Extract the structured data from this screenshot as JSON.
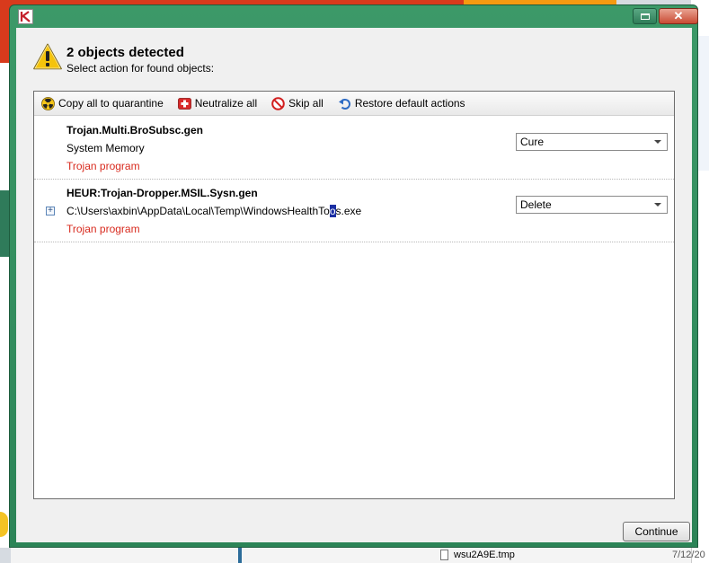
{
  "window": {
    "close_glyph": "✕",
    "app_icon": "kaspersky-k-icon"
  },
  "header": {
    "title": "2 objects detected",
    "subtitle": "Select action for found objects:",
    "icon": "warning-icon"
  },
  "toolbar": {
    "items": [
      {
        "label": "Copy all to quarantine",
        "icon": "radiation-icon"
      },
      {
        "label": "Neutralize all",
        "icon": "first-aid-icon"
      },
      {
        "label": "Skip all",
        "icon": "no-entry-icon"
      },
      {
        "label": "Restore default actions",
        "icon": "undo-icon"
      }
    ]
  },
  "objects": [
    {
      "name": "Trojan.Multi.BroSubsc.gen",
      "location": "System Memory",
      "type": "Trojan program",
      "action": "Cure"
    },
    {
      "name": "HEUR:Trojan-Dropper.MSIL.Sysn.gen",
      "location_prefix": "C:\\Users\\axbin\\AppData\\Local\\Temp\\WindowsHealthTo",
      "location_cursor": "o",
      "location_suffix": "s.exe",
      "type": "Trojan program",
      "action": "Delete",
      "expand_glyph": "+"
    }
  ],
  "footer": {
    "continue_label": "Continue"
  },
  "background": {
    "file_name": "wsu2A9E.tmp",
    "file_date": "7/12/20"
  },
  "colors": {
    "window_frame": "#2c8457",
    "threat_type": "#d82a1e",
    "close_button": "#c94b33"
  }
}
